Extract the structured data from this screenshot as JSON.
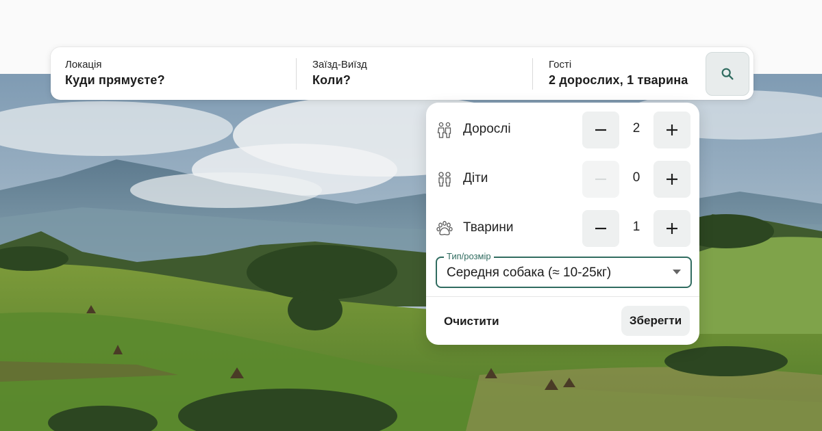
{
  "search": {
    "location": {
      "label": "Локація",
      "value": "Куди прямуєте?"
    },
    "dates": {
      "label": "Заїзд-Виїзд",
      "value": "Коли?"
    },
    "guests": {
      "label": "Гості",
      "value": "2 дорослих, 1 тварина"
    },
    "button_icon": "search-icon"
  },
  "guests_panel": {
    "rows": [
      {
        "label": "Дорослі",
        "count": "2",
        "icon": "adults-icon"
      },
      {
        "label": "Діти",
        "count": "0",
        "icon": "children-icon"
      },
      {
        "label": "Тварини",
        "count": "1",
        "icon": "paw-icon"
      }
    ],
    "pet_type": {
      "label": "Тип/розмір",
      "value": "Середня собака (≈ 10-25кг)"
    },
    "clear_label": "Очистити",
    "save_label": "Зберегти"
  },
  "colors": {
    "accent": "#2f6b5f",
    "button_bg": "#eef0f0"
  }
}
